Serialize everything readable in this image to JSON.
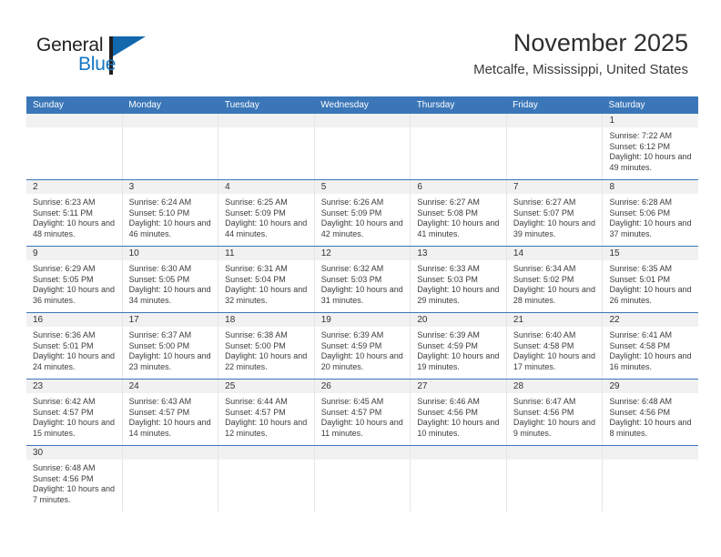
{
  "brand": {
    "name_top": "General",
    "name_bottom": "Blue",
    "accent_color": "#1477c4",
    "triangle_color": "#1168ad"
  },
  "header": {
    "title": "November 2025",
    "subtitle": "Metcalfe, Mississippi, United States",
    "header_bg": "#3a76b8"
  },
  "calendar": {
    "weekdays": [
      "Sunday",
      "Monday",
      "Tuesday",
      "Wednesday",
      "Thursday",
      "Friday",
      "Saturday"
    ],
    "weeks": [
      [
        {
          "day": "",
          "empty": true
        },
        {
          "day": "",
          "empty": true
        },
        {
          "day": "",
          "empty": true
        },
        {
          "day": "",
          "empty": true
        },
        {
          "day": "",
          "empty": true
        },
        {
          "day": "",
          "empty": true
        },
        {
          "day": "1",
          "sunrise": "Sunrise: 7:22 AM",
          "sunset": "Sunset: 6:12 PM",
          "daylight": "Daylight: 10 hours and 49 minutes."
        }
      ],
      [
        {
          "day": "2",
          "sunrise": "Sunrise: 6:23 AM",
          "sunset": "Sunset: 5:11 PM",
          "daylight": "Daylight: 10 hours and 48 minutes."
        },
        {
          "day": "3",
          "sunrise": "Sunrise: 6:24 AM",
          "sunset": "Sunset: 5:10 PM",
          "daylight": "Daylight: 10 hours and 46 minutes."
        },
        {
          "day": "4",
          "sunrise": "Sunrise: 6:25 AM",
          "sunset": "Sunset: 5:09 PM",
          "daylight": "Daylight: 10 hours and 44 minutes."
        },
        {
          "day": "5",
          "sunrise": "Sunrise: 6:26 AM",
          "sunset": "Sunset: 5:09 PM",
          "daylight": "Daylight: 10 hours and 42 minutes."
        },
        {
          "day": "6",
          "sunrise": "Sunrise: 6:27 AM",
          "sunset": "Sunset: 5:08 PM",
          "daylight": "Daylight: 10 hours and 41 minutes."
        },
        {
          "day": "7",
          "sunrise": "Sunrise: 6:27 AM",
          "sunset": "Sunset: 5:07 PM",
          "daylight": "Daylight: 10 hours and 39 minutes."
        },
        {
          "day": "8",
          "sunrise": "Sunrise: 6:28 AM",
          "sunset": "Sunset: 5:06 PM",
          "daylight": "Daylight: 10 hours and 37 minutes."
        }
      ],
      [
        {
          "day": "9",
          "sunrise": "Sunrise: 6:29 AM",
          "sunset": "Sunset: 5:05 PM",
          "daylight": "Daylight: 10 hours and 36 minutes."
        },
        {
          "day": "10",
          "sunrise": "Sunrise: 6:30 AM",
          "sunset": "Sunset: 5:05 PM",
          "daylight": "Daylight: 10 hours and 34 minutes."
        },
        {
          "day": "11",
          "sunrise": "Sunrise: 6:31 AM",
          "sunset": "Sunset: 5:04 PM",
          "daylight": "Daylight: 10 hours and 32 minutes."
        },
        {
          "day": "12",
          "sunrise": "Sunrise: 6:32 AM",
          "sunset": "Sunset: 5:03 PM",
          "daylight": "Daylight: 10 hours and 31 minutes."
        },
        {
          "day": "13",
          "sunrise": "Sunrise: 6:33 AM",
          "sunset": "Sunset: 5:03 PM",
          "daylight": "Daylight: 10 hours and 29 minutes."
        },
        {
          "day": "14",
          "sunrise": "Sunrise: 6:34 AM",
          "sunset": "Sunset: 5:02 PM",
          "daylight": "Daylight: 10 hours and 28 minutes."
        },
        {
          "day": "15",
          "sunrise": "Sunrise: 6:35 AM",
          "sunset": "Sunset: 5:01 PM",
          "daylight": "Daylight: 10 hours and 26 minutes."
        }
      ],
      [
        {
          "day": "16",
          "sunrise": "Sunrise: 6:36 AM",
          "sunset": "Sunset: 5:01 PM",
          "daylight": "Daylight: 10 hours and 24 minutes."
        },
        {
          "day": "17",
          "sunrise": "Sunrise: 6:37 AM",
          "sunset": "Sunset: 5:00 PM",
          "daylight": "Daylight: 10 hours and 23 minutes."
        },
        {
          "day": "18",
          "sunrise": "Sunrise: 6:38 AM",
          "sunset": "Sunset: 5:00 PM",
          "daylight": "Daylight: 10 hours and 22 minutes."
        },
        {
          "day": "19",
          "sunrise": "Sunrise: 6:39 AM",
          "sunset": "Sunset: 4:59 PM",
          "daylight": "Daylight: 10 hours and 20 minutes."
        },
        {
          "day": "20",
          "sunrise": "Sunrise: 6:39 AM",
          "sunset": "Sunset: 4:59 PM",
          "daylight": "Daylight: 10 hours and 19 minutes."
        },
        {
          "day": "21",
          "sunrise": "Sunrise: 6:40 AM",
          "sunset": "Sunset: 4:58 PM",
          "daylight": "Daylight: 10 hours and 17 minutes."
        },
        {
          "day": "22",
          "sunrise": "Sunrise: 6:41 AM",
          "sunset": "Sunset: 4:58 PM",
          "daylight": "Daylight: 10 hours and 16 minutes."
        }
      ],
      [
        {
          "day": "23",
          "sunrise": "Sunrise: 6:42 AM",
          "sunset": "Sunset: 4:57 PM",
          "daylight": "Daylight: 10 hours and 15 minutes."
        },
        {
          "day": "24",
          "sunrise": "Sunrise: 6:43 AM",
          "sunset": "Sunset: 4:57 PM",
          "daylight": "Daylight: 10 hours and 14 minutes."
        },
        {
          "day": "25",
          "sunrise": "Sunrise: 6:44 AM",
          "sunset": "Sunset: 4:57 PM",
          "daylight": "Daylight: 10 hours and 12 minutes."
        },
        {
          "day": "26",
          "sunrise": "Sunrise: 6:45 AM",
          "sunset": "Sunset: 4:57 PM",
          "daylight": "Daylight: 10 hours and 11 minutes."
        },
        {
          "day": "27",
          "sunrise": "Sunrise: 6:46 AM",
          "sunset": "Sunset: 4:56 PM",
          "daylight": "Daylight: 10 hours and 10 minutes."
        },
        {
          "day": "28",
          "sunrise": "Sunrise: 6:47 AM",
          "sunset": "Sunset: 4:56 PM",
          "daylight": "Daylight: 10 hours and 9 minutes."
        },
        {
          "day": "29",
          "sunrise": "Sunrise: 6:48 AM",
          "sunset": "Sunset: 4:56 PM",
          "daylight": "Daylight: 10 hours and 8 minutes."
        }
      ],
      [
        {
          "day": "30",
          "sunrise": "Sunrise: 6:48 AM",
          "sunset": "Sunset: 4:56 PM",
          "daylight": "Daylight: 10 hours and 7 minutes."
        },
        {
          "day": "",
          "empty": true
        },
        {
          "day": "",
          "empty": true
        },
        {
          "day": "",
          "empty": true
        },
        {
          "day": "",
          "empty": true
        },
        {
          "day": "",
          "empty": true
        },
        {
          "day": "",
          "empty": true
        }
      ]
    ]
  }
}
